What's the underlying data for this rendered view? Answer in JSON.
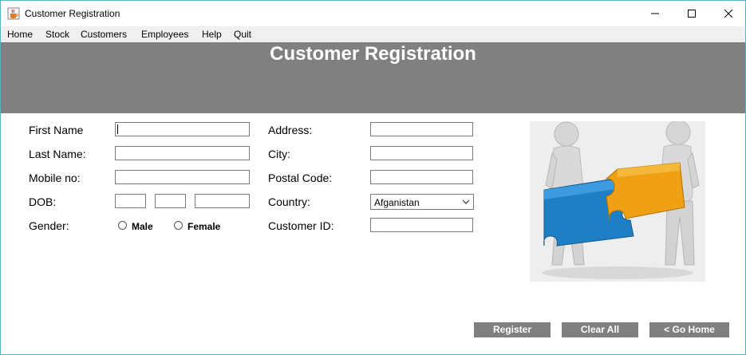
{
  "window": {
    "title": "Customer Registration",
    "icon": "java-cup-icon",
    "controls": [
      "minimize-icon",
      "maximize-icon",
      "close-icon"
    ]
  },
  "menu": {
    "items": [
      {
        "label": "Home"
      },
      {
        "label": "Stock"
      },
      {
        "label": "Customers"
      },
      {
        "label": "Employees"
      },
      {
        "label": "Help"
      },
      {
        "label": "Quit"
      }
    ]
  },
  "banner": {
    "title": "Customer Registration",
    "color": "#808080"
  },
  "form": {
    "first_name": {
      "label": "First Name",
      "value": ""
    },
    "last_name": {
      "label": "Last Name:",
      "value": ""
    },
    "mobile": {
      "label": "Mobile no:",
      "value": ""
    },
    "dob": {
      "label": "DOB:",
      "day": "",
      "month": "",
      "year": ""
    },
    "gender": {
      "label": "Gender:",
      "options": [
        "Male",
        "Female"
      ],
      "selected": ""
    },
    "address": {
      "label": "Address:",
      "value": ""
    },
    "city": {
      "label": "City:",
      "value": ""
    },
    "postal_code": {
      "label": "Postal Code:",
      "value": ""
    },
    "country": {
      "label": "Country:",
      "selected": "Afganistan"
    },
    "customer_id": {
      "label": "Customer ID:",
      "value": ""
    }
  },
  "image": {
    "icon": "puzzle-teamwork-illustration"
  },
  "buttons": {
    "register": "Register",
    "clear_all": "Clear All",
    "go_home": "< Go Home",
    "color": "#808080"
  }
}
